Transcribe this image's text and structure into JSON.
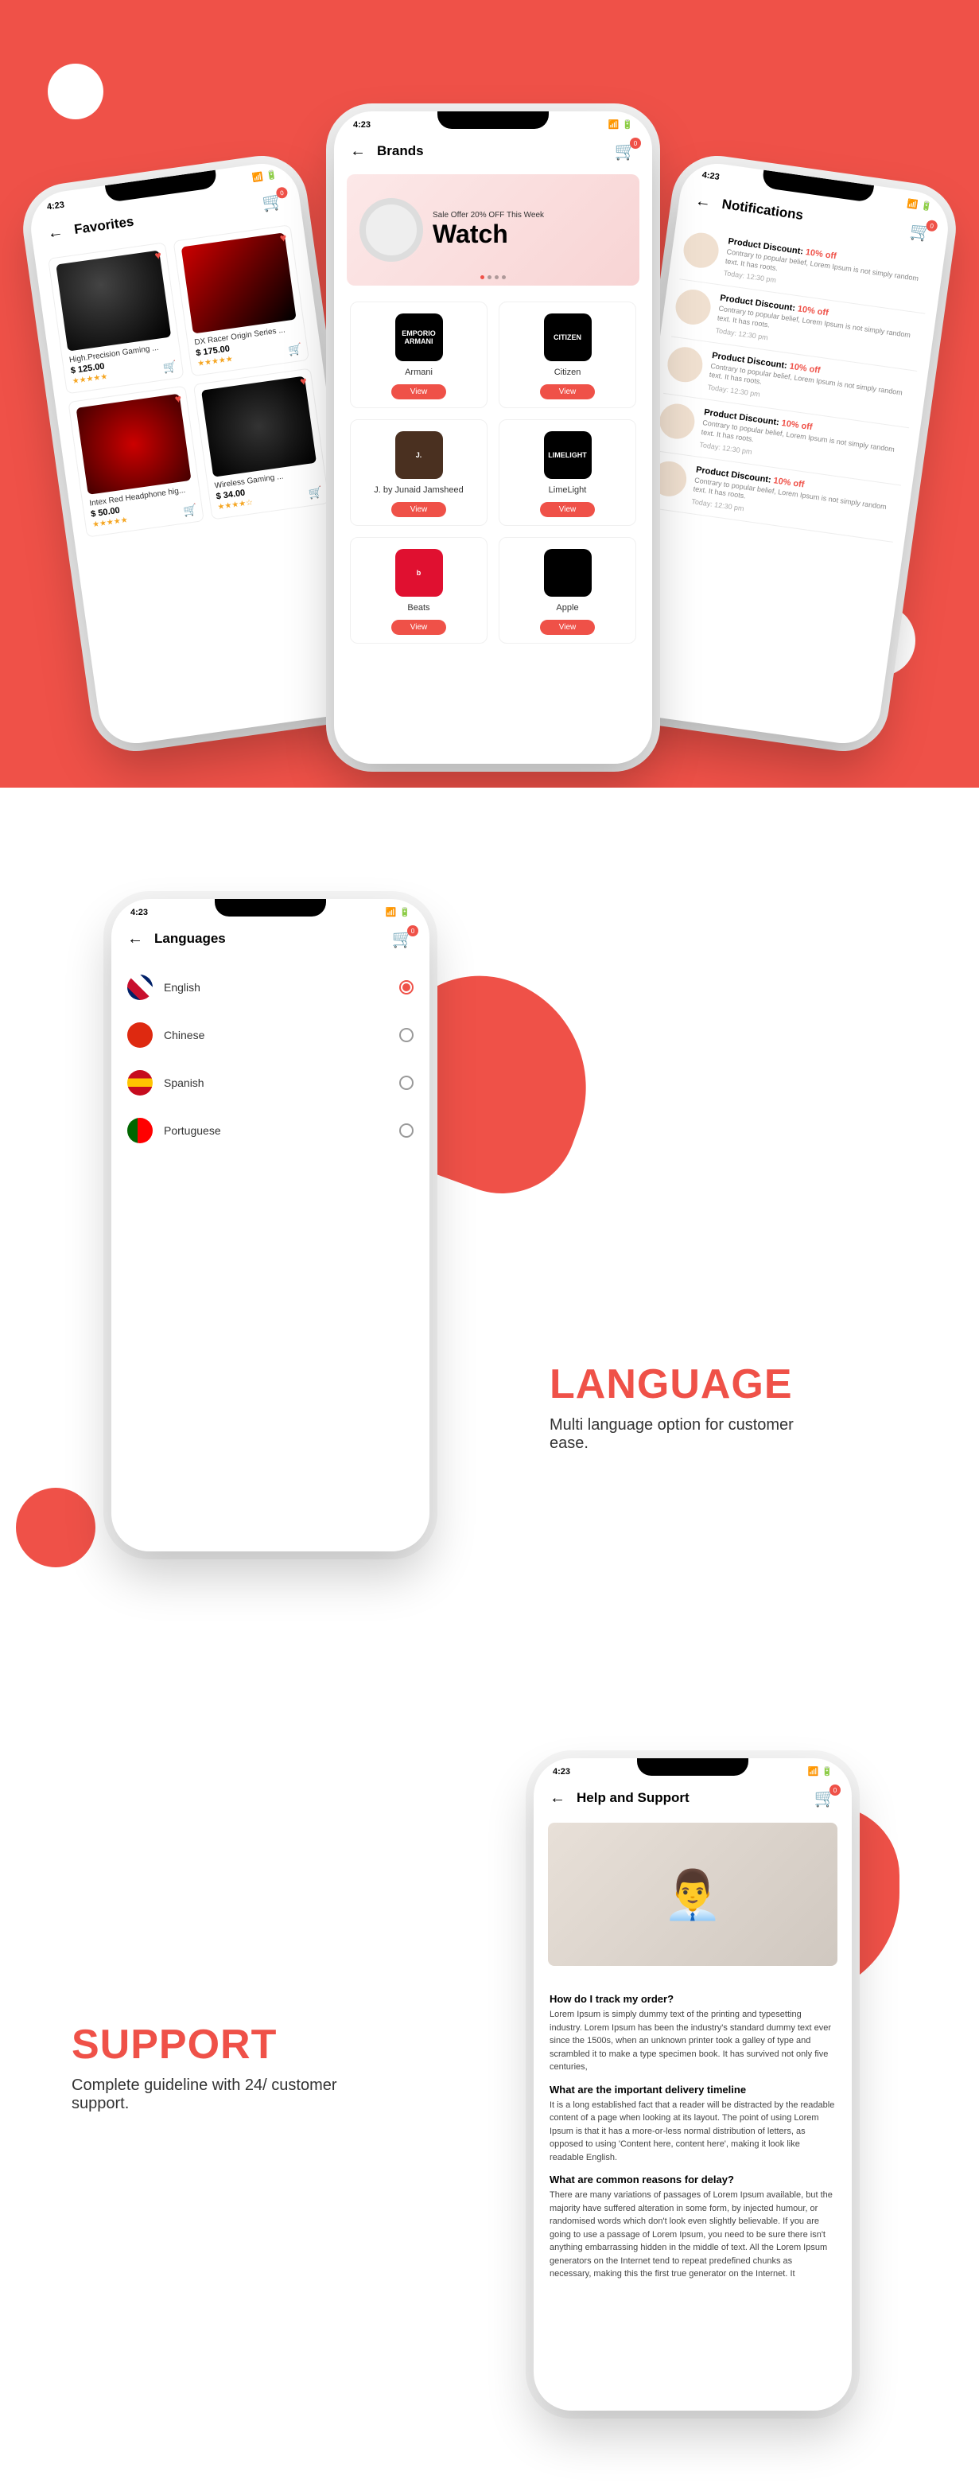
{
  "status_time": "4:23",
  "cart_badge": "0",
  "view_label": "View",
  "favorites": {
    "title": "Favorites",
    "items": [
      {
        "name": "High.Precision Gaming ...",
        "price": "$ 125.00",
        "stars": "★★★★★"
      },
      {
        "name": "DX Racer Origin Series ...",
        "price": "$ 175.00",
        "stars": "★★★★★"
      },
      {
        "name": "Intex Red Headphone hig...",
        "price": "$ 50.00",
        "stars": "★★★★★"
      },
      {
        "name": "Wireless Gaming ...",
        "price": "$ 34.00",
        "stars": "★★★★☆"
      }
    ]
  },
  "brands": {
    "title": "Brands",
    "banner_small": "Sale Offer 20% OFF This Week",
    "banner_big": "Watch",
    "items": [
      {
        "name": "Armani",
        "logo": "EMPORIO ARMANI",
        "bg": "#000"
      },
      {
        "name": "Citizen",
        "logo": "CITIZEN",
        "bg": "#000"
      },
      {
        "name": "J. by Junaid Jamsheed",
        "logo": "J.",
        "bg": "#4a3020"
      },
      {
        "name": "LimeLight",
        "logo": "LIMELIGHT",
        "bg": "#000"
      },
      {
        "name": "Beats",
        "logo": "b",
        "bg": "#e01030"
      },
      {
        "name": "Apple",
        "logo": "",
        "bg": "#000"
      }
    ]
  },
  "notifications": {
    "title": "Notifications",
    "items": [
      {
        "title": "Product Discount:",
        "discount": "10% off",
        "desc": "Contrary to popular belief, Lorem Ipsum is not simply random text. It has roots.",
        "time": "Today: 12:30 pm"
      },
      {
        "title": "Product Discount:",
        "discount": "10% off",
        "desc": "Contrary to popular belief, Lorem Ipsum is not simply random text. It has roots.",
        "time": "Today: 12:30 pm"
      },
      {
        "title": "Product Discount:",
        "discount": "10% off",
        "desc": "Contrary to popular belief, Lorem Ipsum is not simply random text. It has roots.",
        "time": "Today: 12:30 pm"
      },
      {
        "title": "Product Discount:",
        "discount": "10% off",
        "desc": "Contrary to popular belief, Lorem Ipsum is not simply random text. It has roots.",
        "time": "Today: 12:30 pm"
      },
      {
        "title": "Product Discount:",
        "discount": "10% off",
        "desc": "Contrary to popular belief, Lorem Ipsum is not simply random text. It has roots.",
        "time": "Today: 12:30 pm"
      }
    ]
  },
  "languages": {
    "title": "Languages",
    "headline": "LANGUAGE",
    "subhead": "Multi language option for customer ease.",
    "items": [
      {
        "name": "English",
        "selected": true
      },
      {
        "name": "Chinese",
        "selected": false
      },
      {
        "name": "Spanish",
        "selected": false
      },
      {
        "name": "Portuguese",
        "selected": false
      }
    ]
  },
  "support": {
    "title": "Help and Support",
    "headline": "SUPPORT",
    "subhead": "Complete guideline with 24/ customer support.",
    "faq": [
      {
        "q": "How do I track my order?",
        "a": "Lorem Ipsum is simply dummy text of the printing and typesetting industry. Lorem Ipsum has been the industry's standard dummy text ever since the 1500s, when an unknown printer took a galley of type and scrambled it to make a type specimen book. It has survived not only five centuries,"
      },
      {
        "q": "What are the important delivery timeline",
        "a": "It is a long established fact that a reader will be distracted by the readable content of a page when looking at its layout. The point of using Lorem Ipsum is that it has a more-or-less normal distribution of letters, as opposed to using 'Content here, content here', making it look like readable English."
      },
      {
        "q": "What are common reasons for delay?",
        "a": "There are many variations of passages of Lorem Ipsum available, but the majority have suffered alteration in some form, by injected humour, or randomised words which don't look even slightly believable. If you are going to use a passage of Lorem Ipsum, you need to be sure there isn't anything embarrassing hidden in the middle of text. All the Lorem Ipsum generators on the Internet tend to repeat predefined chunks as necessary, making this the first true generator on the Internet. It"
      }
    ]
  }
}
